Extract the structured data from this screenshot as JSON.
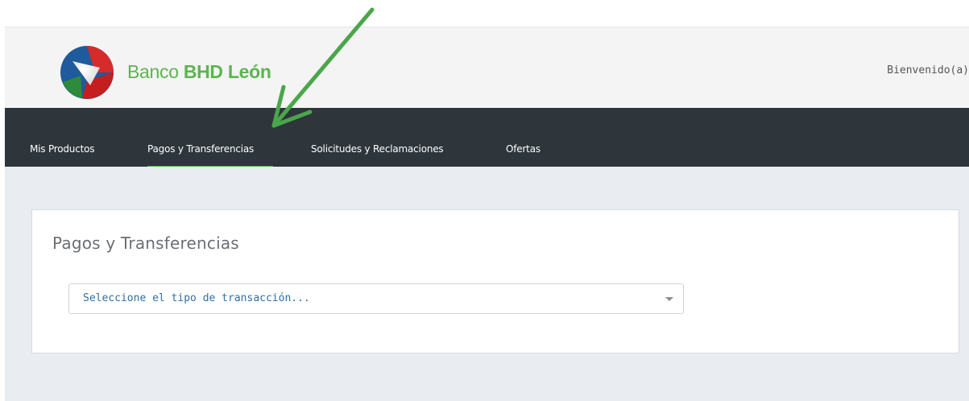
{
  "header": {
    "brand_prefix": "Banco",
    "brand_bold": "BHD León",
    "welcome_text": "Bienvenido(a)"
  },
  "nav": {
    "items": [
      {
        "label": "Mis Productos"
      },
      {
        "label": "Pagos y Transferencias",
        "active": true
      },
      {
        "label": "Solicitudes y Reclamaciones"
      },
      {
        "label": "Ofertas"
      }
    ]
  },
  "main": {
    "title": "Pagos y Transferencias",
    "transaction_select": {
      "value": "Seleccione el tipo de transacción..."
    }
  },
  "colors": {
    "brand_green": "#5cb54f",
    "navbar": "#2e353b",
    "annotation_arrow": "#4aa64a"
  }
}
